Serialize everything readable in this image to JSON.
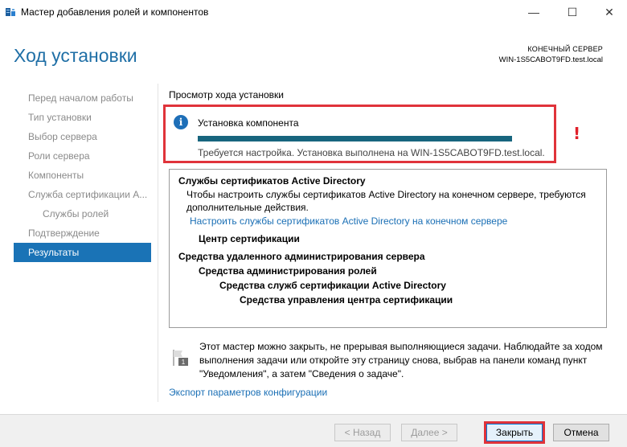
{
  "window": {
    "title": "Мастер добавления ролей и компонентов",
    "minimize_glyph": "—",
    "maximize_glyph": "☐",
    "close_glyph": "✕"
  },
  "header": {
    "page_title": "Ход установки",
    "destination_label": "КОНЕЧНЫЙ СЕРВЕР",
    "destination_server": "WIN-1S5CABOT9FD.test.local"
  },
  "sidebar": {
    "items": [
      {
        "label": "Перед началом работы",
        "level": 0,
        "active": false
      },
      {
        "label": "Тип установки",
        "level": 0,
        "active": false
      },
      {
        "label": "Выбор сервера",
        "level": 0,
        "active": false
      },
      {
        "label": "Роли сервера",
        "level": 0,
        "active": false
      },
      {
        "label": "Компоненты",
        "level": 0,
        "active": false
      },
      {
        "label": "Служба сертификации A...",
        "level": 0,
        "active": false
      },
      {
        "label": "Службы ролей",
        "level": 1,
        "active": false
      },
      {
        "label": "Подтверждение",
        "level": 0,
        "active": false
      },
      {
        "label": "Результаты",
        "level": 0,
        "active": true
      }
    ]
  },
  "main": {
    "section_title": "Просмотр хода установки",
    "status": {
      "icon": "info-icon",
      "icon_glyph": "i",
      "heading": "Установка компонента",
      "progress_percent": 100,
      "message": "Требуется настройка. Установка выполнена на WIN-1S5CABOT9FD.test.local.",
      "alert_mark": "!"
    },
    "results": {
      "adcs_title": "Службы сертификатов Active Directory",
      "adcs_desc_line1": "Чтобы настроить службы сертификатов Active Directory на конечном сервере, требуются",
      "adcs_desc_line2": "дополнительные действия.",
      "adcs_link": "Настроить службы сертификатов Active Directory на конечном сервере",
      "ca": "Центр сертификации",
      "rsat": "Средства удаленного администрирования сервера",
      "role_tools": "Средства администрирования ролей",
      "adcs_tools": "Средства служб сертификации Active Directory",
      "ca_tools": "Средства управления центра сертификации"
    },
    "note_line1": "Этот мастер можно закрыть, не прерывая выполняющиеся задачи. Наблюдайте за ходом",
    "note_line2": "выполнения задачи или откройте эту страницу снова, выбрав на панели команд пункт",
    "note_line3": "\"Уведомления\", а затем \"Сведения о задаче\".",
    "note_badge": "1",
    "export_link": "Экспорт параметров конфигурации"
  },
  "footer": {
    "back_label": "< Назад",
    "next_label": "Далее >",
    "close_label": "Закрыть",
    "cancel_label": "Отмена"
  },
  "colors": {
    "accent": "#1a73b6",
    "title_blue": "#1f6fa6",
    "progress": "#17657e",
    "highlight_red": "#e0333a",
    "link": "#1a6fb5"
  }
}
